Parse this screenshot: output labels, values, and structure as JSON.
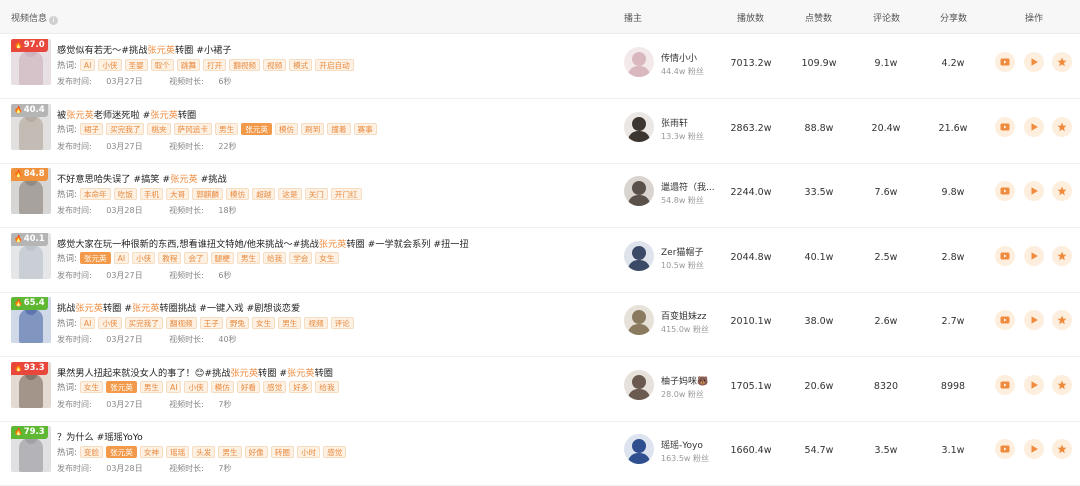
{
  "header": {
    "video_info": "视频信息",
    "blogger": "播主",
    "plays": "播放数",
    "likes": "点赞数",
    "comments": "评论数",
    "shares": "分享数",
    "actions": "操作",
    "info_icon": "info-icon"
  },
  "labels": {
    "tags_prefix": "热词:",
    "published_prefix": "发布时间:",
    "duration_prefix": "视频时长:",
    "fans_suffix": "粉丝"
  },
  "colors": {
    "score_red": "#e8473c",
    "score_gray": "#b5b5b5",
    "score_orange": "#f0913b",
    "score_green": "#5fb834",
    "accent": "#f08a3c",
    "tag_bg": "#fdf1e4"
  },
  "rows": [
    {
      "score": "97.0",
      "score_color": "#e8473c",
      "title": "感觉似有若无～#挑战张元英转圈 #小裙子",
      "tags": [
        "AI",
        "小侠",
        "圣婴",
        "取个",
        "跳舞",
        "打开",
        "翻视频",
        "视频",
        "模式",
        "开启自动"
      ],
      "active_tag": -1,
      "published": "03月27日",
      "duration": "6秒",
      "blogger": "传情小小",
      "fans": "44.4w",
      "plays": "7013.2w",
      "likes": "109.9w",
      "comments": "9.1w",
      "shares": "4.2w"
    },
    {
      "score": "40.4",
      "score_color": "#b5b5b5",
      "title": "被张元英老师迷死啦 #张元英转圈",
      "tags": [
        "裙子",
        "买完我了",
        "桃夹",
        "萨冈追卡",
        "男生",
        "张元英",
        "模仿",
        "刷到",
        "撞着",
        "赛事"
      ],
      "active_tag": 5,
      "published": "03月27日",
      "duration": "22秒",
      "blogger": "张雨轩",
      "fans": "13.3w",
      "plays": "2863.2w",
      "likes": "88.8w",
      "comments": "20.4w",
      "shares": "21.6w"
    },
    {
      "score": "84.8",
      "score_color": "#f0913b",
      "title": "不好意思哈失误了 #搞笑 #张元英 #挑战",
      "tags": [
        "本命年",
        "吃饭",
        "手机",
        "大哥",
        "郭麒麟",
        "模仿",
        "超越",
        "这是",
        "关门",
        "开门红"
      ],
      "active_tag": -1,
      "published": "03月28日",
      "duration": "18秒",
      "blogger": "邋遢符（我...",
      "fans": "54.8w",
      "plays": "2244.0w",
      "likes": "33.5w",
      "comments": "7.6w",
      "shares": "9.8w"
    },
    {
      "score": "40.1",
      "score_color": "#b5b5b5",
      "title": "感觉大家在玩一种很新的东西,想看谁扭文特她/他来挑战～#挑战张元英转圈 #一学就会系列 #扭一扭",
      "tags": [
        "张元英",
        "AI",
        "小侠",
        "教程",
        "会了",
        "腿梗",
        "男生",
        "给我",
        "学会",
        "女生"
      ],
      "active_tag": 0,
      "published": "03月27日",
      "duration": "6秒",
      "blogger": "Zer猫帽子",
      "fans": "10.5w",
      "plays": "2044.8w",
      "likes": "40.1w",
      "comments": "2.5w",
      "shares": "2.8w"
    },
    {
      "score": "65.4",
      "score_color": "#5fb834",
      "title": "挑战张元英转圈 #张元英转圈挑战 #一键入戏 #剧想谈恋爱",
      "tags": [
        "AI",
        "小侠",
        "买完我了",
        "翻视频",
        "王子",
        "野兔",
        "女生",
        "男生",
        "视频",
        "评论"
      ],
      "active_tag": -1,
      "published": "03月27日",
      "duration": "40秒",
      "blogger": "百变姐妹zz",
      "fans": "415.0w",
      "plays": "2010.1w",
      "likes": "38.0w",
      "comments": "2.6w",
      "shares": "2.7w"
    },
    {
      "score": "93.3",
      "score_color": "#e8473c",
      "title": "果然男人扭起来就没女人的事了！😊#挑战张元英转圈 #张元英转圈",
      "tags": [
        "女生",
        "张元英",
        "男生",
        "AI",
        "小侠",
        "模仿",
        "好看",
        "感觉",
        "好多",
        "给我"
      ],
      "active_tag": 1,
      "published": "03月27日",
      "duration": "7秒",
      "blogger": "柚子妈咪🐻",
      "fans": "28.0w",
      "plays": "1705.1w",
      "likes": "20.6w",
      "comments": "8320",
      "shares": "8998"
    },
    {
      "score": "79.3",
      "score_color": "#5fb834",
      "title": "？为什么 #瑶瑶YoYo",
      "tags": [
        "变脸",
        "张元英",
        "女神",
        "瑶瑶",
        "头发",
        "男生",
        "好像",
        "转圈",
        "小时",
        "感觉"
      ],
      "active_tag": 1,
      "published": "03月28日",
      "duration": "7秒",
      "blogger": "瑶瑶-Yoyo",
      "fans": "163.5w",
      "plays": "1660.4w",
      "likes": "54.7w",
      "comments": "3.5w",
      "shares": "3.1w"
    }
  ]
}
